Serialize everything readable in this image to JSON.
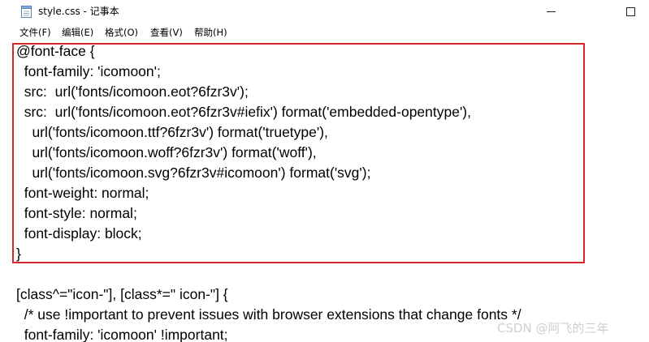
{
  "window": {
    "title": "style.css - 记事本",
    "icon": "notepad-icon"
  },
  "menu": [
    "文件(F)",
    "编辑(E)",
    "格式(O)",
    "查看(V)",
    "帮助(H)"
  ],
  "editor": {
    "lines": [
      "@font-face {",
      "  font-family: 'icomoon';",
      "  src:  url('fonts/icomoon.eot?6fzr3v');",
      "  src:  url('fonts/icomoon.eot?6fzr3v#iefix') format('embedded-opentype'),",
      "    url('fonts/icomoon.ttf?6fzr3v') format('truetype'),",
      "    url('fonts/icomoon.woff?6fzr3v') format('woff'),",
      "    url('fonts/icomoon.svg?6fzr3v#icomoon') format('svg');",
      "  font-weight: normal;",
      "  font-style: normal;",
      "  font-display: block;",
      "}",
      "",
      "[class^=\"icon-\"], [class*=\" icon-\"] {",
      "  /* use !important to prevent issues with browser extensions that change fonts */",
      "  font-family: 'icomoon' !important;"
    ],
    "highlight_color": "#d9262d"
  },
  "watermark": "CSDN @阿飞的三年"
}
